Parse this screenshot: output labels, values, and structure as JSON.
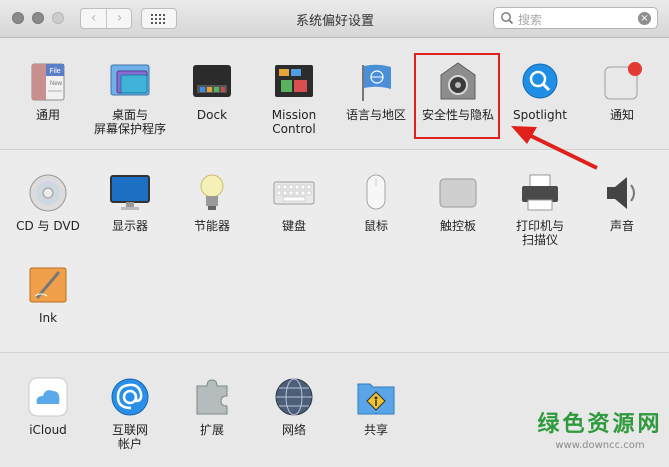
{
  "window": {
    "title": "系统偏好设置",
    "nav_back": "‹",
    "nav_forward": "›"
  },
  "search": {
    "placeholder": "搜索",
    "clear": "×"
  },
  "sections": {
    "personal": [
      {
        "label": "通用",
        "icon": "general-icon"
      },
      {
        "label": "桌面与\n屏幕保护程序",
        "icon": "desktop-screensaver-icon"
      },
      {
        "label": "Dock",
        "icon": "dock-icon"
      },
      {
        "label": "Mission\nControl",
        "icon": "mission-control-icon"
      },
      {
        "label": "语言与地区",
        "icon": "language-region-icon"
      },
      {
        "label": "安全性与隐私",
        "icon": "security-privacy-icon"
      },
      {
        "label": "Spotlight",
        "icon": "spotlight-icon"
      },
      {
        "label": "通知",
        "icon": "notifications-icon"
      }
    ],
    "hardware": [
      {
        "label": "CD 与 DVD",
        "icon": "cd-dvd-icon"
      },
      {
        "label": "显示器",
        "icon": "displays-icon"
      },
      {
        "label": "节能器",
        "icon": "energy-saver-icon"
      },
      {
        "label": "键盘",
        "icon": "keyboard-icon"
      },
      {
        "label": "鼠标",
        "icon": "mouse-icon"
      },
      {
        "label": "触控板",
        "icon": "trackpad-icon"
      },
      {
        "label": "打印机与\n扫描仪",
        "icon": "printers-scanners-icon"
      },
      {
        "label": "声音",
        "icon": "sound-icon"
      },
      {
        "label": "Ink",
        "icon": "ink-icon"
      }
    ],
    "internet": [
      {
        "label": "iCloud",
        "icon": "icloud-icon"
      },
      {
        "label": "互联网\n帐户",
        "icon": "internet-accounts-icon"
      },
      {
        "label": "扩展",
        "icon": "extensions-icon"
      },
      {
        "label": "网络",
        "icon": "network-icon"
      },
      {
        "label": "共享",
        "icon": "sharing-icon"
      }
    ]
  },
  "icon_text": {
    "general_file_label": "File",
    "general_new_label": "New"
  },
  "annotation": {
    "highlight_color": "#e0201b",
    "highlighted_item": "安全性与隐私"
  },
  "watermark": {
    "title": "绿色资源网",
    "url": "www.downcc.com",
    "color": "#2e9a3c"
  }
}
